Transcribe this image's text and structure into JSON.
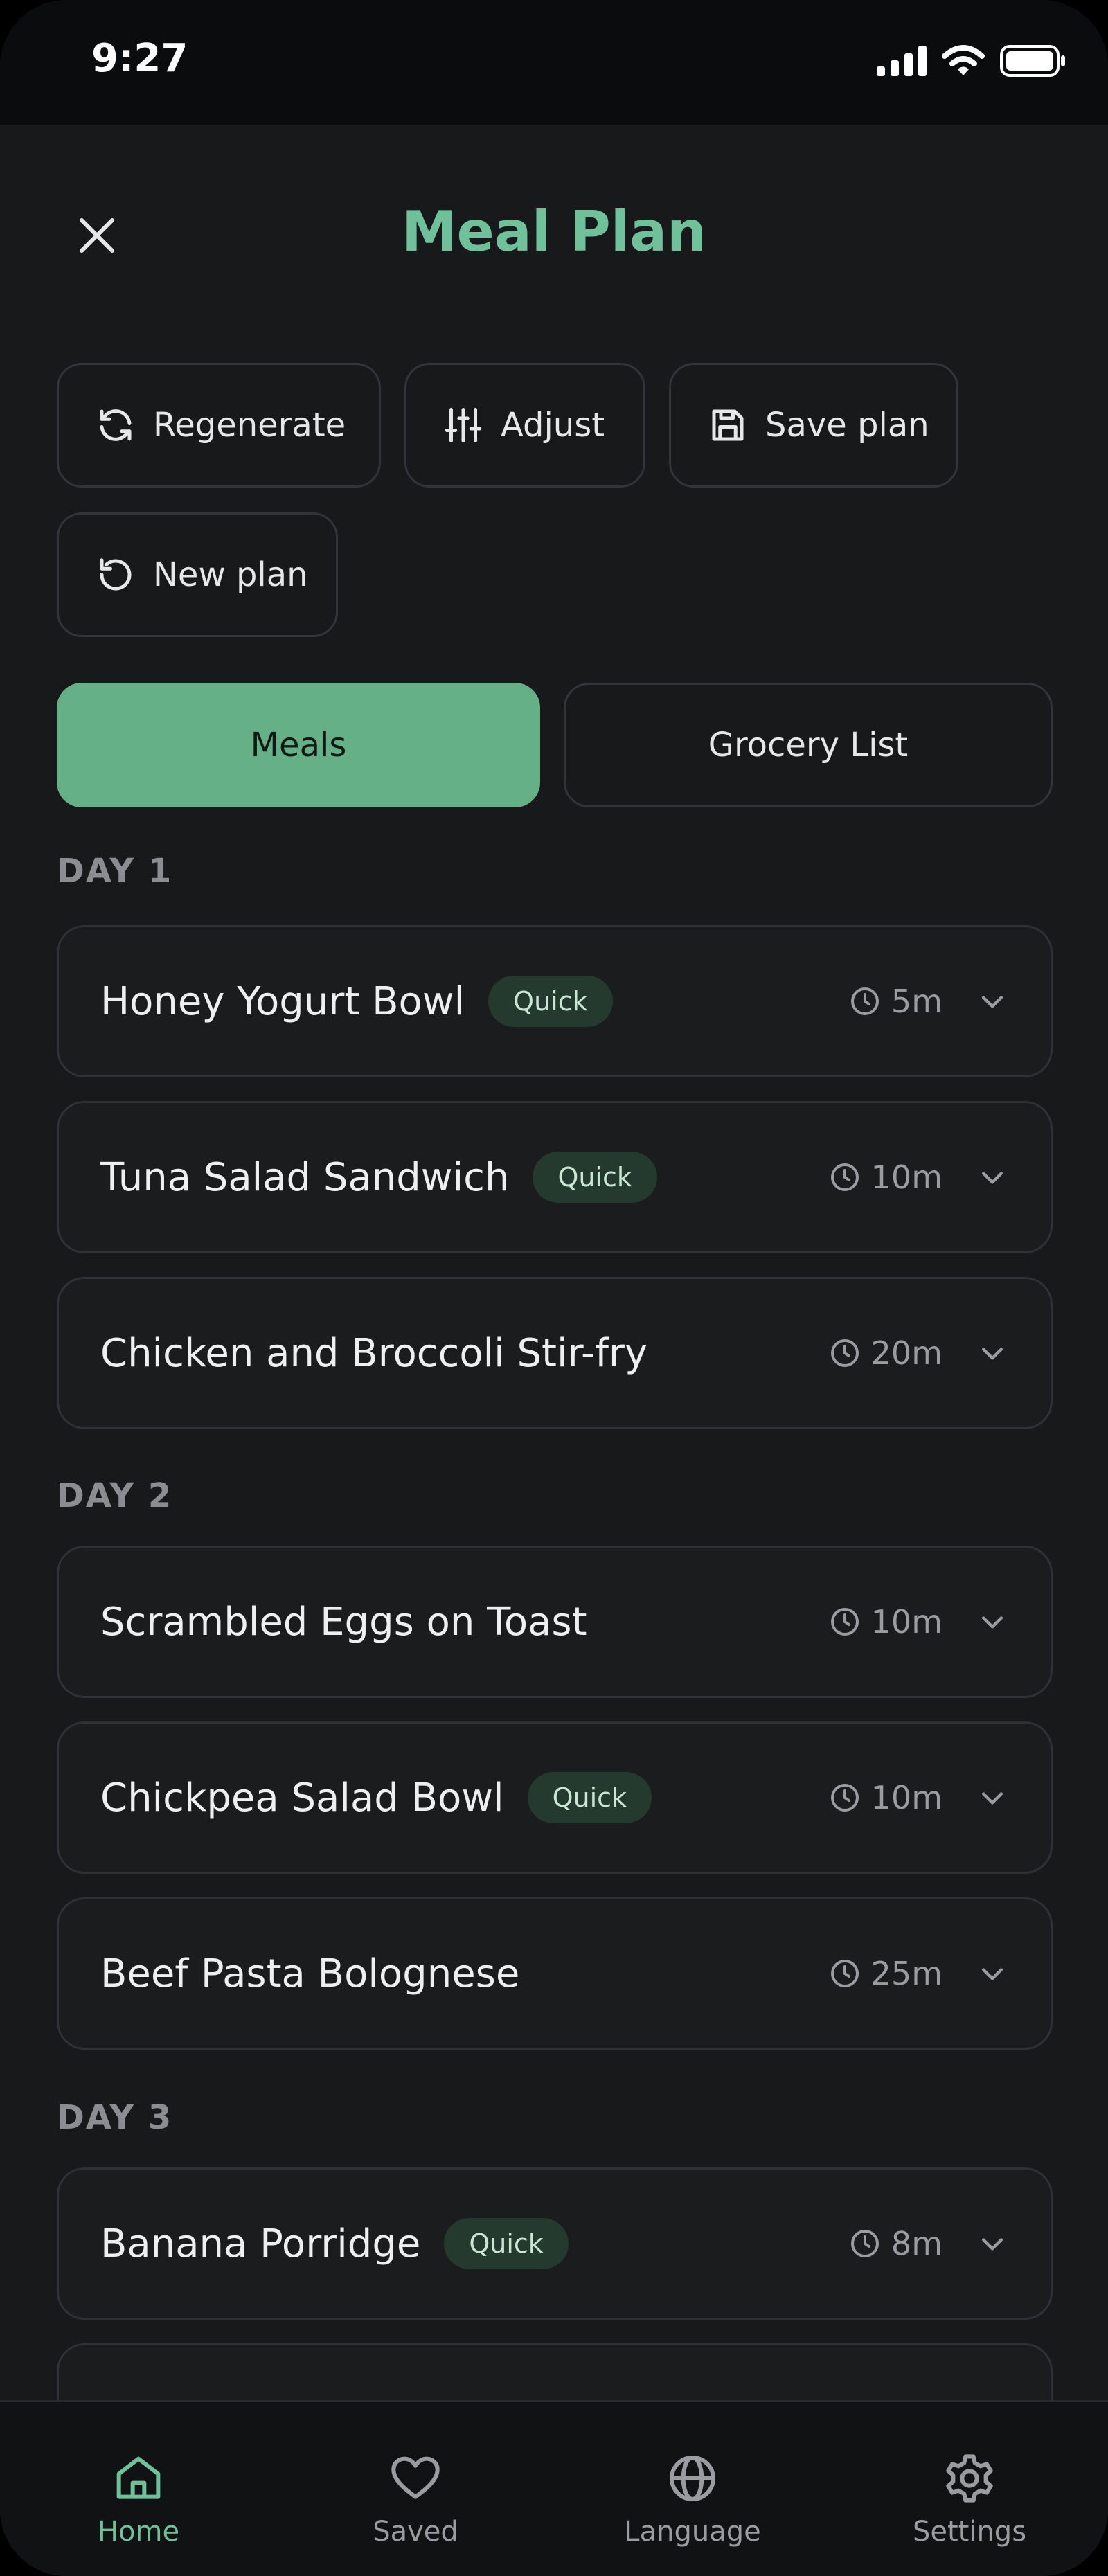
{
  "status": {
    "time": "9:27"
  },
  "header": {
    "title": "Meal Plan"
  },
  "actions": {
    "regenerate": "Regenerate",
    "adjust": "Adjust",
    "save_plan": "Save plan",
    "new_plan": "New plan"
  },
  "tabs": {
    "meals": "Meals",
    "grocery": "Grocery List"
  },
  "days": [
    {
      "label": "DAY 1",
      "meals": [
        {
          "name": "Honey Yogurt Bowl",
          "badge": "Quick",
          "time": "5m"
        },
        {
          "name": "Tuna Salad Sandwich",
          "badge": "Quick",
          "time": "10m"
        },
        {
          "name": "Chicken and Broccoli Stir-fry",
          "time": "20m"
        }
      ]
    },
    {
      "label": "DAY 2",
      "meals": [
        {
          "name": "Scrambled Eggs on Toast",
          "time": "10m"
        },
        {
          "name": "Chickpea Salad Bowl",
          "badge": "Quick",
          "time": "10m"
        },
        {
          "name": "Beef Pasta Bolognese",
          "time": "25m"
        }
      ]
    },
    {
      "label": "DAY 3",
      "meals": [
        {
          "name": "Banana Porridge",
          "badge": "Quick",
          "time": "8m"
        }
      ]
    }
  ],
  "nav": {
    "home": "Home",
    "saved": "Saved",
    "language": "Language",
    "settings": "Settings"
  },
  "colors": {
    "accent": "#6fc19a",
    "background": "#18191b",
    "badge_bg": "#243a2f"
  }
}
